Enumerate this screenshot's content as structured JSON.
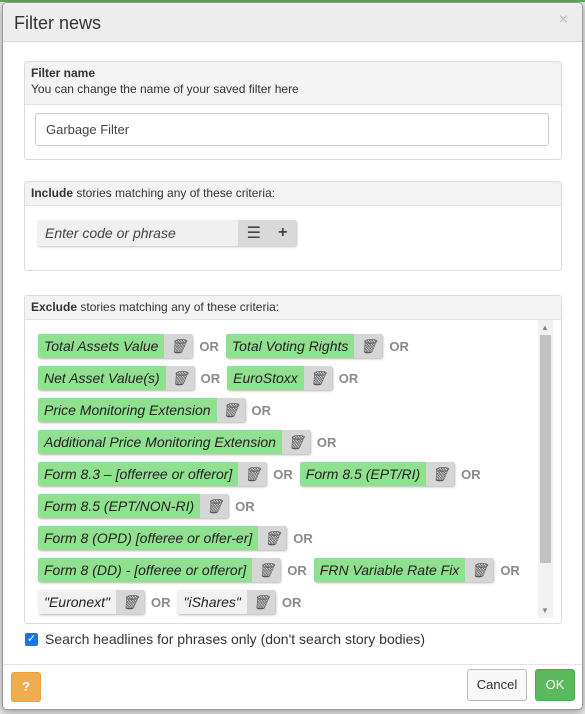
{
  "dialog": {
    "title": "Filter news",
    "close_glyph": "×"
  },
  "filter_name": {
    "label": "Filter name",
    "hint": "You can change the name of your saved filter here",
    "value": "Garbage Filter"
  },
  "include": {
    "heading_bold": "Include",
    "heading_rest": " stories matching any of these criteria:",
    "placeholder": "Enter code or phrase"
  },
  "exclude": {
    "heading_bold": "Exclude",
    "heading_rest": " stories matching any of these criteria:",
    "or_label": "OR",
    "rows": [
      [
        {
          "text": "Total Assets Value",
          "style": "green"
        },
        {
          "text": "Total Voting Rights",
          "style": "green"
        }
      ],
      [
        {
          "text": "Net Asset Value(s)",
          "style": "green"
        },
        {
          "text": "EuroStoxx",
          "style": "green"
        }
      ],
      [
        {
          "text": "Price Monitoring Extension",
          "style": "green"
        }
      ],
      [
        {
          "text": "Additional Price Monitoring Extension",
          "style": "green"
        }
      ],
      [
        {
          "text": "Form 8.3 – [offerree or offeror]",
          "style": "green"
        },
        {
          "text": "Form 8.5 (EPT/RI)",
          "style": "green"
        }
      ],
      [
        {
          "text": "Form 8.5 (EPT/NON-RI)",
          "style": "green"
        }
      ],
      [
        {
          "text": "Form 8 (OPD) [offeree or offer-er]",
          "style": "green"
        }
      ],
      [
        {
          "text": "Form 8 (DD) - [offeree or offeror]",
          "style": "green"
        },
        {
          "text": "FRN Variable Rate Fix",
          "style": "green"
        }
      ],
      [
        {
          "text": "\"Euronext\"",
          "style": "grey"
        },
        {
          "text": "\"iShares\"",
          "style": "grey"
        }
      ]
    ]
  },
  "options": {
    "headlines_only_label": "Search headlines for phrases only (don't search story bodies)",
    "headlines_only_checked": true
  },
  "footer": {
    "help_label": "?",
    "cancel_label": "Cancel",
    "ok_label": "OK"
  },
  "colors": {
    "tag_green": "#8fe08f",
    "ok_green": "#5cb85c",
    "help_orange": "#f0ad4e",
    "checkbox_blue": "#1a73e8"
  },
  "icons": {
    "close": "close-icon",
    "list": "list-icon",
    "add": "plus-icon",
    "delete": "trash-icon",
    "checkbox": "check-icon"
  }
}
